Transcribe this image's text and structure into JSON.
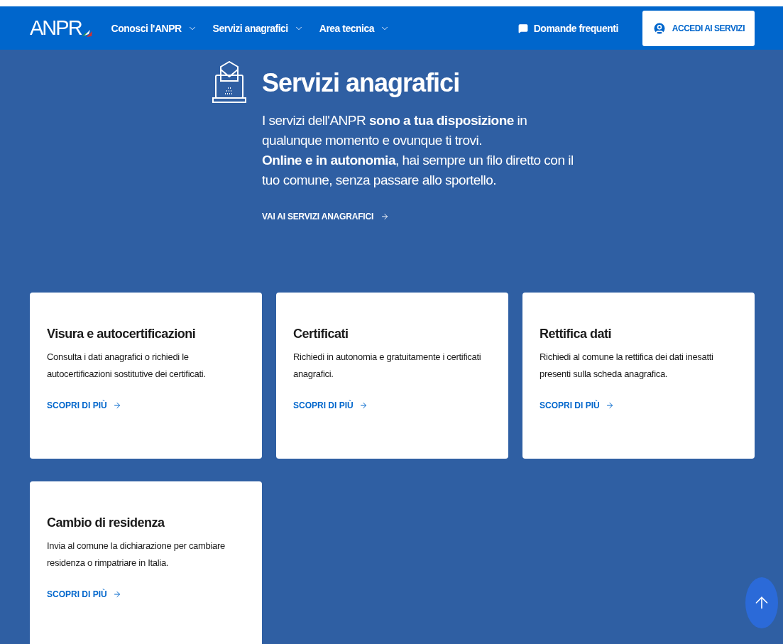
{
  "header": {
    "logo": "ANPR",
    "nav": [
      {
        "label": "Conosci l'ANPR"
      },
      {
        "label": "Servizi anagrafici"
      },
      {
        "label": "Area tecnica"
      }
    ],
    "faq": "Domande frequenti",
    "login": "ACCEDI AI SERVIZI"
  },
  "hero": {
    "title": "Servizi anagrafici",
    "paragraphs": [
      "I servizi dell'ANPR **sono a tua disposizione** in qualunque momento e ovunque ti trovi.",
      "**Online e in autonomia**, hai sempre un filo diretto con il tuo comune, senza passare allo sportello."
    ],
    "link": "VAI AI SERVIZI ANAGRAFICI"
  },
  "cards": [
    {
      "title": "Visura e autocertificazioni",
      "text": "Consulta i dati anagrafici o richiedi le autocertificazioni sostitutive dei certificati.",
      "link": "SCOPRI DI PIÙ"
    },
    {
      "title": "Certificati",
      "text": "Richiedi in autonomia e gratuitamente i certificati anagrafici.",
      "link": "SCOPRI DI PIÙ"
    },
    {
      "title": "Rettifica dati",
      "text": "Richiedi al comune la rettifica dei dati inesatti presenti sulla scheda anagrafica.",
      "link": "SCOPRI DI PIÙ"
    },
    {
      "title": "Cambio di residenza",
      "text": "Invia al comune la dichiarazione per cambiare residenza o rimpatriare in Italia.",
      "link": "SCOPRI DI PIÙ"
    }
  ]
}
